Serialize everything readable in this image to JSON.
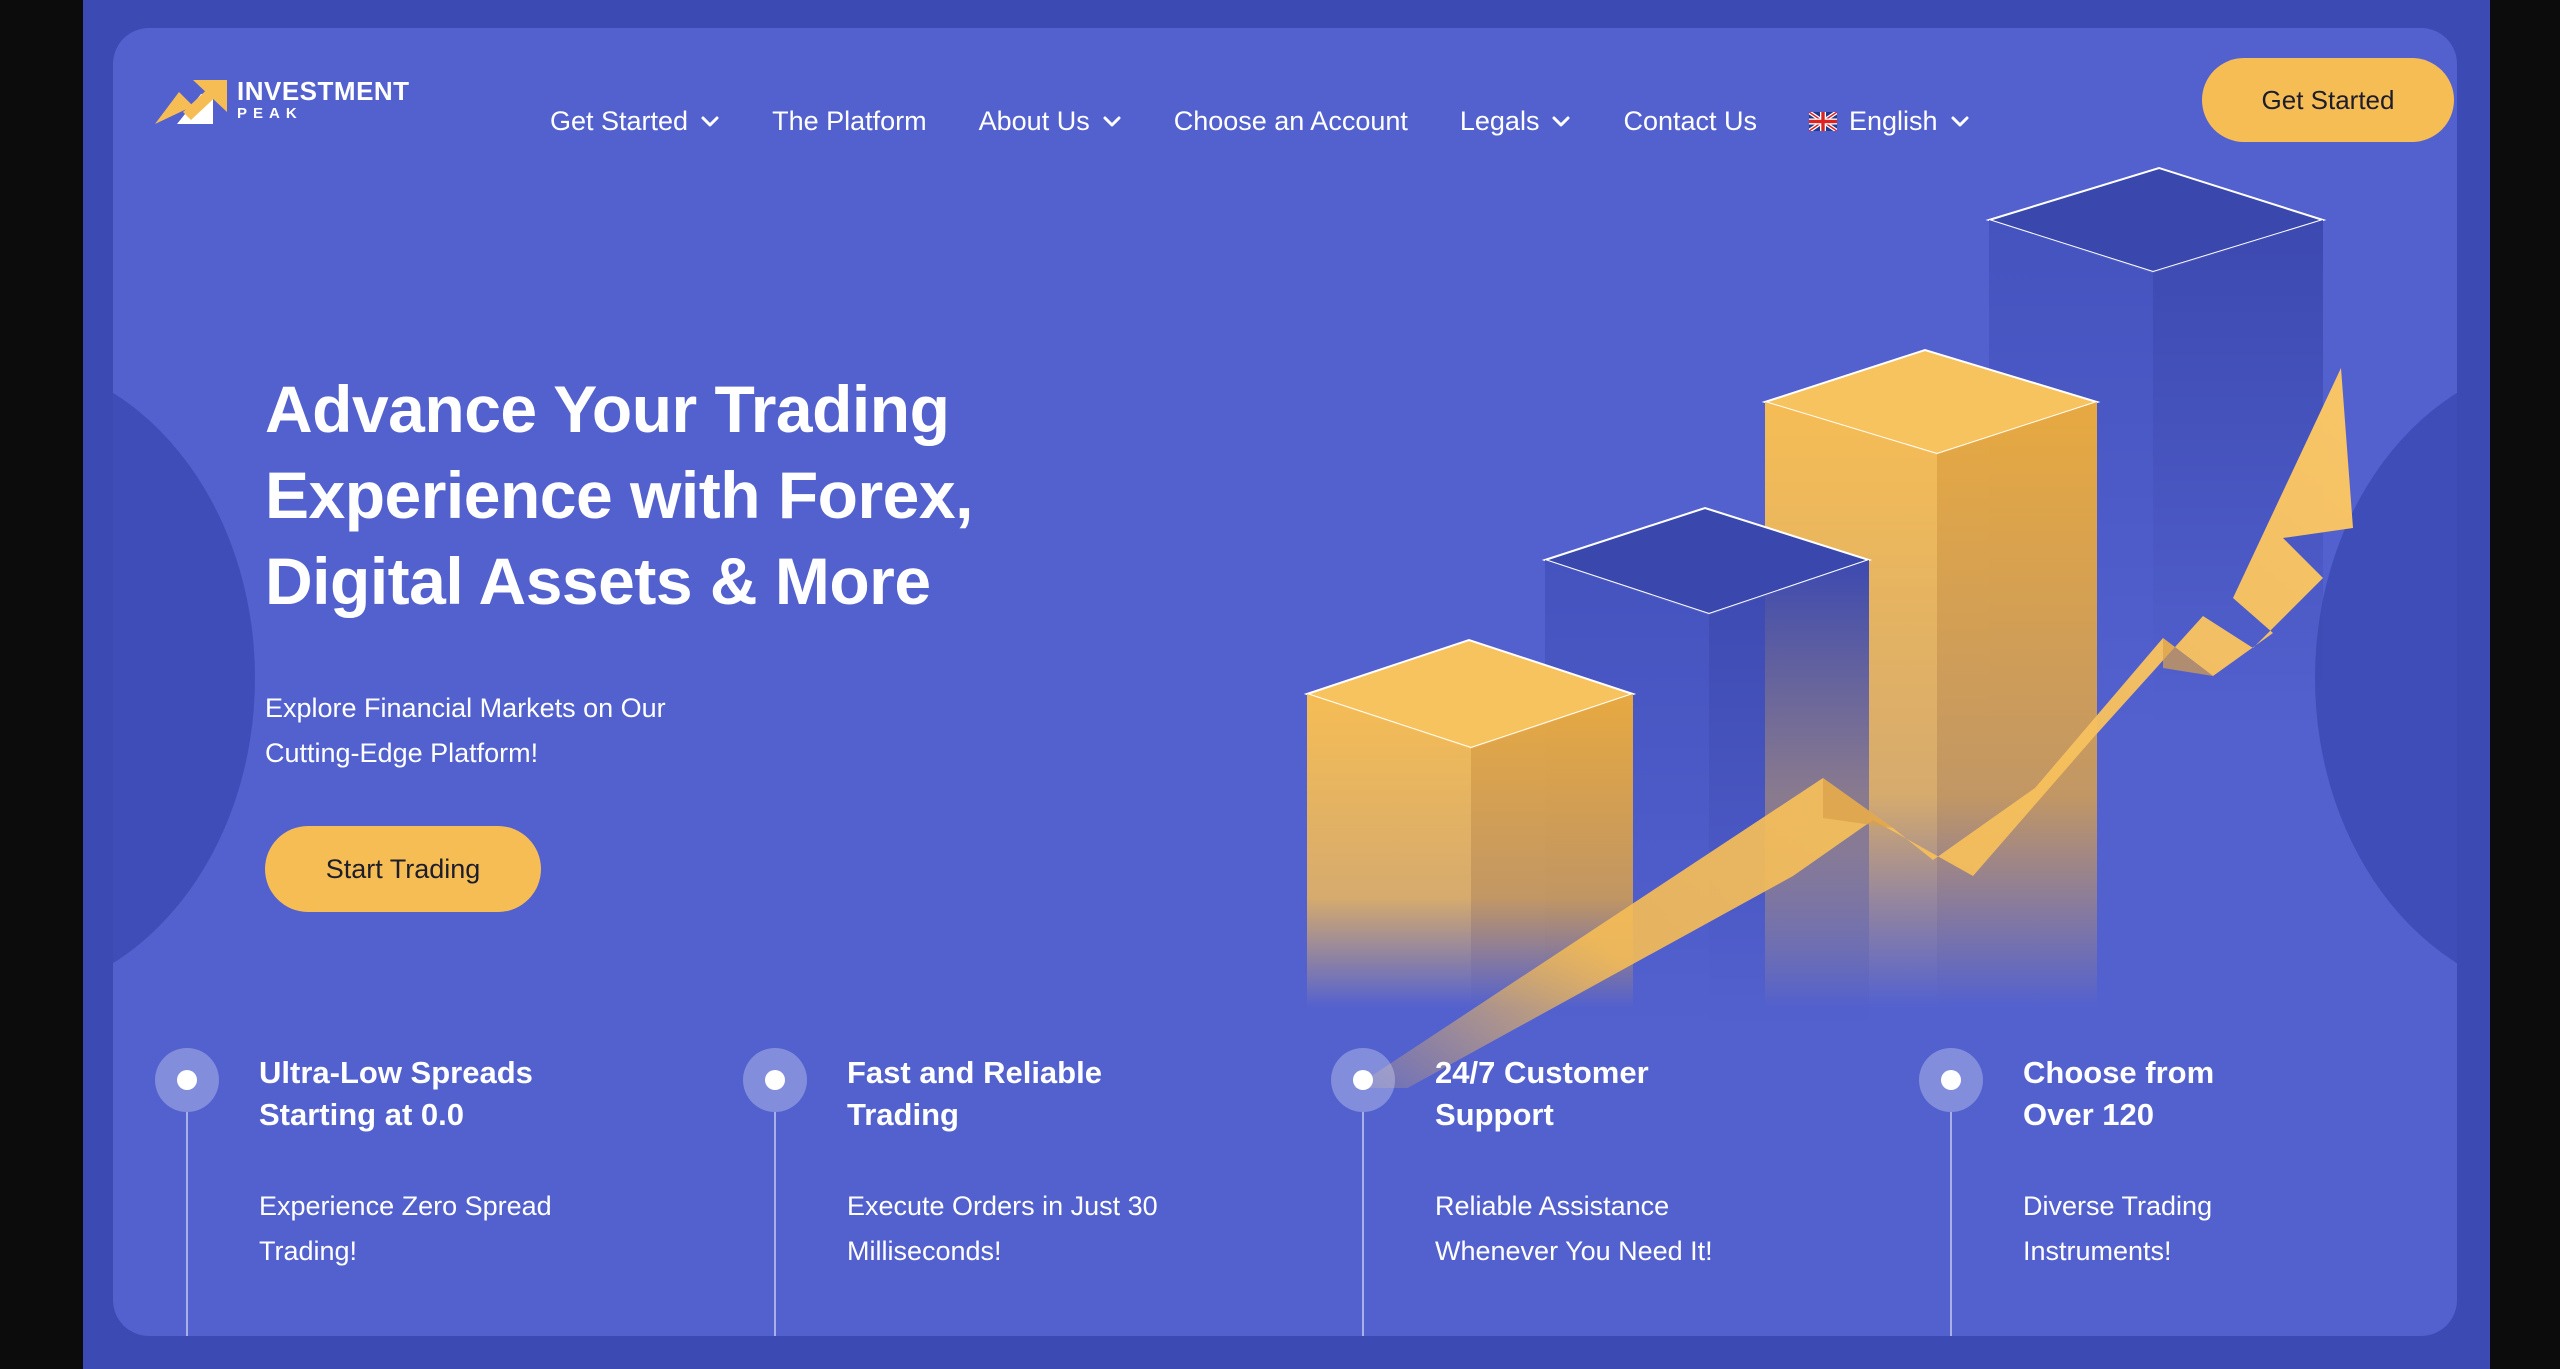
{
  "brand": {
    "name_line1": "INVESTMENT",
    "name_line2": "PEAK",
    "accent_color": "#f6bd55",
    "background_color": "#5361cf"
  },
  "nav": {
    "items": [
      {
        "label": "Get Started",
        "dropdown": true
      },
      {
        "label": "The Platform",
        "dropdown": false
      },
      {
        "label": "About Us",
        "dropdown": true
      },
      {
        "label": "Choose an Account",
        "dropdown": false
      },
      {
        "label": "Legals",
        "dropdown": true
      },
      {
        "label": "Contact Us",
        "dropdown": false
      }
    ],
    "language": {
      "label": "English",
      "icon": "uk-flag-icon"
    },
    "cta_label": "Get Started"
  },
  "hero": {
    "title_lines": [
      "Advance Your Trading",
      "Experience with Forex,",
      "Digital Assets & More"
    ],
    "subtitle_lines": [
      "Explore Financial Markets on Our",
      "Cutting-Edge Platform!"
    ],
    "cta_label": "Start Trading"
  },
  "features": [
    {
      "title_lines": [
        "Ultra-Low Spreads",
        "Starting at 0.0"
      ],
      "desc_lines": [
        "Experience Zero Spread",
        "Trading!"
      ]
    },
    {
      "title_lines": [
        "Fast and Reliable",
        "Trading"
      ],
      "desc_lines": [
        "Execute Orders in Just 30",
        "Milliseconds!"
      ]
    },
    {
      "title_lines": [
        "24/7 Customer",
        "Support"
      ],
      "desc_lines": [
        "Reliable Assistance",
        "Whenever You Need It!"
      ]
    },
    {
      "title_lines": [
        "Choose from",
        "Over 120"
      ],
      "desc_lines": [
        "Diverse Trading",
        "Instruments!"
      ]
    }
  ]
}
